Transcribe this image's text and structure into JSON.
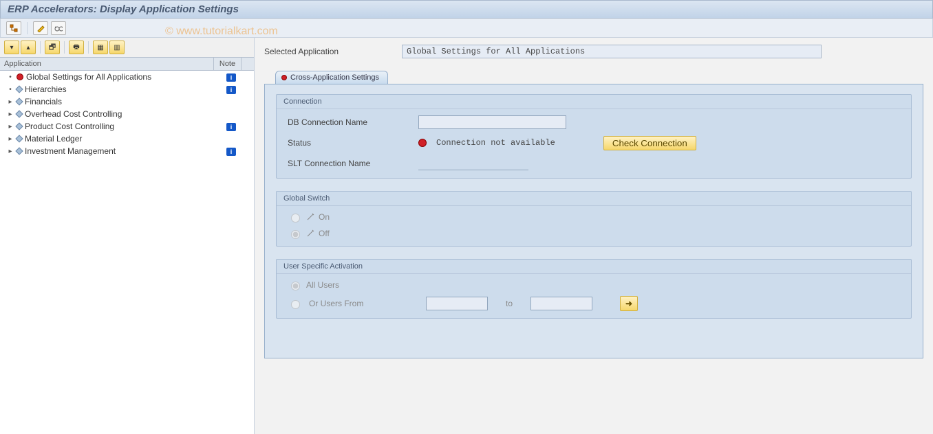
{
  "title": "ERP Accelerators: Display Application Settings",
  "watermark": "© www.tutorialkart.com",
  "toolbar_top": {
    "tree_btn": "tree",
    "pencil_btn": "pencil",
    "wrench_btn": "wrench"
  },
  "left_toolbar": {
    "collapse": "▾",
    "expand": "▴",
    "find": "🔍",
    "layout": "⧉",
    "grid": "▦",
    "export": "⇲"
  },
  "tree": {
    "header_app": "Application",
    "header_note": "Note",
    "items": [
      {
        "expander": "•",
        "icon": "red-dot",
        "label": "Global Settings for All Applications",
        "note": true
      },
      {
        "expander": "•",
        "icon": "diamond",
        "label": "Hierarchies",
        "note": true
      },
      {
        "expander": "▸",
        "icon": "diamond",
        "label": "Financials",
        "note": false
      },
      {
        "expander": "▸",
        "icon": "diamond",
        "label": "Overhead Cost Controlling",
        "note": false
      },
      {
        "expander": "▸",
        "icon": "diamond",
        "label": "Product Cost Controlling",
        "note": true
      },
      {
        "expander": "▸",
        "icon": "diamond",
        "label": "Material Ledger",
        "note": false
      },
      {
        "expander": "▸",
        "icon": "diamond",
        "label": "Investment Management",
        "note": true
      }
    ]
  },
  "selected_app": {
    "label": "Selected Application",
    "value": "Global Settings for All Applications"
  },
  "tab": {
    "label": "Cross-Application Settings"
  },
  "connection": {
    "title": "Connection",
    "db_label": "DB Connection Name",
    "db_value": "",
    "status_label": "Status",
    "status_text": "Connection not available",
    "check_btn": "Check Connection",
    "slt_label": "SLT Connection Name",
    "slt_value": ""
  },
  "global_switch": {
    "title": "Global Switch",
    "on_label": "On",
    "off_label": "Off"
  },
  "user_activation": {
    "title": "User Specific Activation",
    "all_users": "All Users",
    "or_from": "Or Users From",
    "to": "to",
    "from_value": "",
    "to_value": ""
  },
  "info_badge": "i"
}
